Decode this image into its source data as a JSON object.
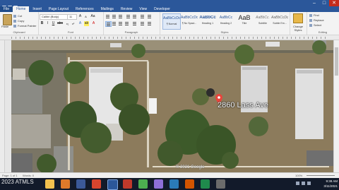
{
  "titlebar": {
    "minimize": "–",
    "maximize": "□",
    "close": "✕"
  },
  "menu": {
    "tabs": [
      "File",
      "Home",
      "Insert",
      "Page Layout",
      "References",
      "Mailings",
      "Review",
      "View",
      "Developer"
    ],
    "active": "Home"
  },
  "ribbon": {
    "clipboard": {
      "paste": "Paste",
      "cut": "Cut",
      "copy": "Copy",
      "format_painter": "Format Painter",
      "group_label": "Clipboard"
    },
    "font": {
      "family": "Calibri (Body)",
      "size": "11",
      "bold": "B",
      "italic": "I",
      "underline": "U",
      "group_label": "Font"
    },
    "paragraph": {
      "group_label": "Paragraph"
    },
    "styles": {
      "group_label": "Styles",
      "items": [
        {
          "sample": "AaBbCcDc",
          "name": "¶ Normal"
        },
        {
          "sample": "AaBbCcDc",
          "name": "¶ No Spaci..."
        },
        {
          "sample": "AaBbCc",
          "name": "Heading 1"
        },
        {
          "sample": "AaBbCc",
          "name": "Heading 2"
        },
        {
          "sample": "AaB",
          "name": "Title"
        },
        {
          "sample": "AaBbCc.",
          "name": "Subtitle"
        },
        {
          "sample": "AaBbCcDc",
          "name": "Subtle Em..."
        }
      ],
      "change_styles": "Change Styles"
    },
    "editing": {
      "find": "Find",
      "replace": "Replace",
      "select": "Select",
      "group_label": "Editing"
    }
  },
  "document": {
    "map": {
      "address_label": "2860 Lass Ave",
      "copyright": "© 2021 Google",
      "pin_color": "#e8453c"
    }
  },
  "statusbar": {
    "page": "Page: 1 of 1",
    "words": "Words: 0",
    "zoom": "100%"
  },
  "taskbar": {
    "watermark": "2023 ATMLS",
    "time": "9:38 AM",
    "date": "3/11/2021"
  },
  "colors": {
    "word_blue": "#2b579a",
    "taskbar": "#121a2a"
  }
}
